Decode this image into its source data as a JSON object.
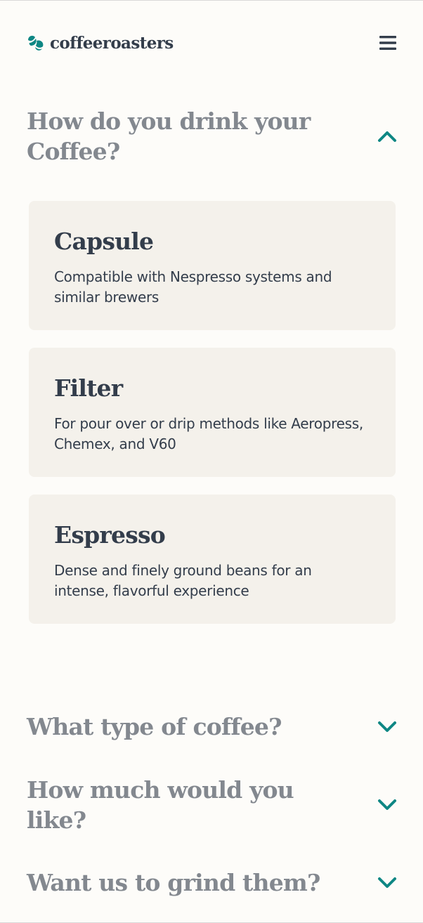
{
  "header": {
    "logo_text": "coffeeroasters",
    "logo_icon": "coffee-bean-icon",
    "menu_icon": "hamburger-menu-icon"
  },
  "colors": {
    "accent": "#0e8784",
    "dark": "#333d4b",
    "muted": "#83888f",
    "card": "#f4f1eb",
    "background": "#fdfcf9"
  },
  "sections": [
    {
      "title": "How do you drink your Coffee?",
      "expanded": true,
      "options": [
        {
          "title": "Capsule",
          "description": "Compatible with Nespresso systems and similar brewers"
        },
        {
          "title": "Filter",
          "description": "For pour over or drip methods like Aeropress, Chemex, and V60"
        },
        {
          "title": "Espresso",
          "description": "Dense and finely ground beans for an intense, flavorful experience"
        }
      ]
    },
    {
      "title": "What type of coffee?",
      "expanded": false
    },
    {
      "title": "How much would you like?",
      "expanded": false
    },
    {
      "title": "Want us to grind them?",
      "expanded": false
    }
  ]
}
